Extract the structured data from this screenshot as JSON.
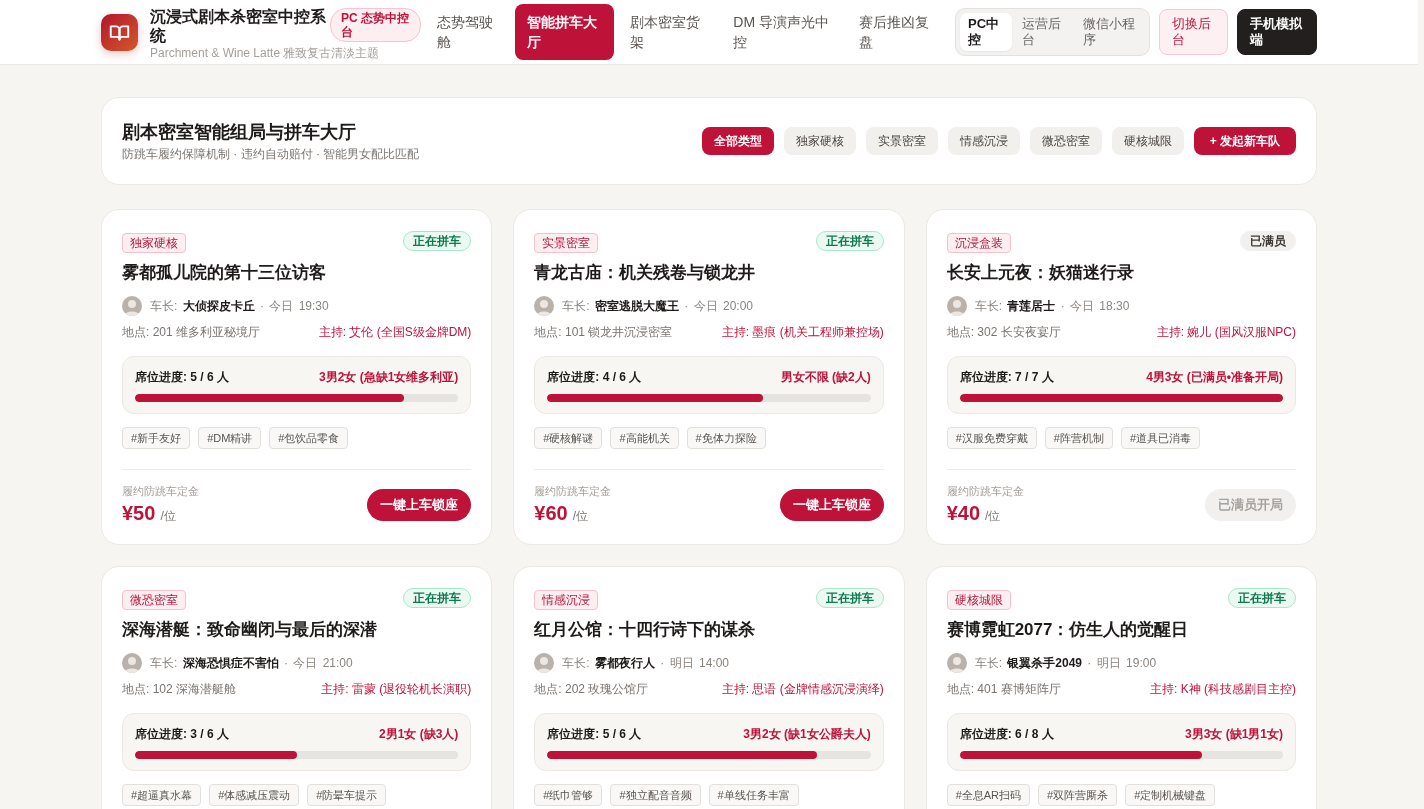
{
  "header": {
    "title": "沉浸式剧本杀密室中控系统",
    "subtitle": "Parchment & Wine Latte 雅致复古清淡主题",
    "badge": "PC 态势中控台",
    "nav": [
      {
        "label": "态势驾驶舱",
        "selected": false
      },
      {
        "label": "智能拼车大厅",
        "selected": true
      },
      {
        "label": "剧本密室货架",
        "selected": false
      },
      {
        "label": "DM 导演声光中控",
        "selected": false
      },
      {
        "label": "赛后推凶复盘",
        "selected": false
      }
    ],
    "platforms": [
      {
        "label": "PC中控",
        "selected": true
      },
      {
        "label": "运营后台",
        "selected": false
      },
      {
        "label": "微信小程序",
        "selected": false
      }
    ],
    "actions": [
      {
        "label": "切换后台",
        "kind": "soft"
      },
      {
        "label": "手机模拟端",
        "kind": "dark"
      }
    ]
  },
  "hall": {
    "title": "剧本密室智能组局与拼车大厅",
    "subtitle": "防跳车履约保障机制 · 违约自动赔付 · 智能男女配比匹配",
    "filters": [
      {
        "label": "全部类型",
        "selected": true
      },
      {
        "label": "独家硬核",
        "selected": false
      },
      {
        "label": "实景密室",
        "selected": false
      },
      {
        "label": "情感沉浸",
        "selected": false
      },
      {
        "label": "微恐密室",
        "selected": false
      },
      {
        "label": "硬核城限",
        "selected": false
      }
    ],
    "create_button": "+ 发起新车队"
  },
  "cards": [
    {
      "category": "独家硬核",
      "status": {
        "label": "正在拼车",
        "kind": "open"
      },
      "title": "雾都孤儿院的第十三位访客",
      "captain": "车长: **大侦探皮卡丘** · 今日 19:30",
      "location": "地点: 201 维多利亚秘境厅",
      "host": "主持: 艾伦 (全国S级金牌DM)",
      "progress": {
        "label": "席位进度: 5 / 6 人",
        "note": "3男2女 (急缺1女维多利亚)",
        "level": 0.833
      },
      "tags": [
        "#新手友好",
        "#DM精讲",
        "#包饮品零食"
      ],
      "deposit_label": "履约防跳车定金",
      "price": "¥50",
      "unit": "/位",
      "button": {
        "label": "一键上车锁座",
        "disabled": false
      }
    },
    {
      "category": "实景密室",
      "status": {
        "label": "正在拼车",
        "kind": "open"
      },
      "title": "青龙古庙：机关残卷与锁龙井",
      "captain": "车长: **密室逃脱大魔王** · 今日 20:00",
      "location": "地点: 101 锁龙井沉浸密室",
      "host": "主持: 墨痕 (机关工程师兼控场)",
      "progress": {
        "label": "席位进度: 4 / 6 人",
        "note": "男女不限 (缺2人)",
        "level": 0.667
      },
      "tags": [
        "#硬核解谜",
        "#高能机关",
        "#免体力探险"
      ],
      "deposit_label": "履约防跳车定金",
      "price": "¥60",
      "unit": "/位",
      "button": {
        "label": "一键上车锁座",
        "disabled": false
      }
    },
    {
      "category": "沉浸盒装",
      "status": {
        "label": "已满员",
        "kind": "full"
      },
      "title": "长安上元夜：妖猫迷行录",
      "captain": "车长: **青莲居士** · 今日 18:30",
      "location": "地点: 302 长安夜宴厅",
      "host": "主持: 婉儿 (国风汉服NPC)",
      "progress": {
        "label": "席位进度: 7 / 7 人",
        "note": "4男3女 (已满员•准备开局)",
        "level": 1
      },
      "tags": [
        "#汉服免费穿戴",
        "#阵营机制",
        "#道具已消毒"
      ],
      "deposit_label": "履约防跳车定金",
      "price": "¥40",
      "unit": "/位",
      "button": {
        "label": "已满员开局",
        "disabled": true
      }
    },
    {
      "category": "微恐密室",
      "status": {
        "label": "正在拼车",
        "kind": "open"
      },
      "title": "深海潜艇：致命幽闭与最后的深潜",
      "captain": "车长: **深海恐惧症不害怕** · 今日 21:00",
      "location": "地点: 102 深海潜艇舱",
      "host": "主持: 雷蒙 (退役轮机长演职)",
      "progress": {
        "label": "席位进度: 3 / 6 人",
        "note": "2男1女 (缺3人)",
        "level": 0.5
      },
      "tags": [
        "#超逼真水幕",
        "#体感减压震动",
        "#防晕车提示"
      ]
    },
    {
      "category": "情感沉浸",
      "status": {
        "label": "正在拼车",
        "kind": "open"
      },
      "title": "红月公馆：十四行诗下的谋杀",
      "captain": "车长: **雾都夜行人** · 明日 14:00",
      "location": "地点: 202 玫瑰公馆厅",
      "host": "主持: 思语 (金牌情感沉浸演绎)",
      "progress": {
        "label": "席位进度: 5 / 6 人",
        "note": "3男2女 (缺1女公爵夫人)",
        "level": 0.833
      },
      "tags": [
        "#纸巾管够",
        "#独立配音音频",
        "#单线任务丰富"
      ]
    },
    {
      "category": "硬核城限",
      "status": {
        "label": "正在拼车",
        "kind": "open"
      },
      "title": "赛博霓虹2077：仿生人的觉醒日",
      "captain": "车长: **银翼杀手2049** · 明日 19:00",
      "location": "地点: 401 赛博矩阵厅",
      "host": "主持: K神 (科技感剧目主控)",
      "progress": {
        "label": "席位进度: 6 / 8 人",
        "note": "3男3女 (缺1男1女)",
        "level": 0.75
      },
      "tags": [
        "#全息AR扫码",
        "#双阵营厮杀",
        "#定制机械键盘"
      ]
    }
  ]
}
